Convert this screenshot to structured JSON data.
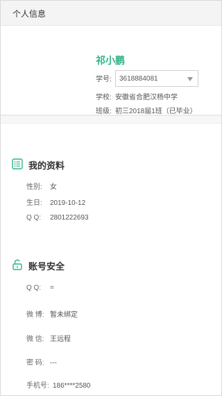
{
  "header": {
    "title": "个人信息"
  },
  "profile": {
    "name": "祁小鹏",
    "student_id_label": "学号:",
    "student_id_value": "3618884081",
    "school_label": "学校:",
    "school_value": "安徽省合肥汉杨中学",
    "class_label": "班级:",
    "class_value": "初三2018届1班（已毕业）"
  },
  "my_profile": {
    "title": "我的资料",
    "icon": "list-icon",
    "rows": [
      {
        "key": "性别:",
        "value": "女"
      },
      {
        "key": "生日:",
        "value": "2019-10-12"
      },
      {
        "key": "Q Q:",
        "value": "2801222693"
      }
    ]
  },
  "account_security": {
    "title": "账号安全",
    "icon": "unlock-icon",
    "rows": [
      {
        "key": "Q Q:",
        "value": "="
      },
      {
        "key": "微 博:",
        "value": "暂未绑定"
      },
      {
        "key": "微 信:",
        "value": "王远程"
      },
      {
        "key": "密 码:",
        "value": "---"
      },
      {
        "key": "手机号:",
        "value": "186****2580"
      }
    ]
  },
  "colors": {
    "accent": "#2fb38a",
    "header_bg": "#f4f4f4"
  }
}
